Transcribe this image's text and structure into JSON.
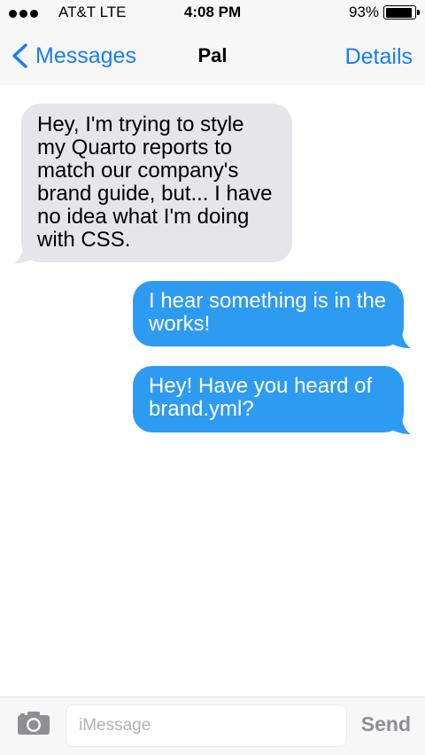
{
  "status_bar": {
    "carrier": "AT&T  LTE",
    "time": "4:08 PM",
    "battery": "93%",
    "battery_level": 0.93
  },
  "nav": {
    "back_label": "Messages",
    "title": "Pal",
    "details_label": "Details",
    "accent_color": "#1a7cf2"
  },
  "messages": [
    {
      "direction": "received",
      "text": "Hey, I'm trying to style\nmy Quarto reports to\nmatch our company's\nbrand guide, but... I have\nno idea what I'm doing\nwith CSS."
    },
    {
      "direction": "sent",
      "text": "I hear something is in the\nworks!"
    },
    {
      "direction": "sent",
      "text": "Hey! Have you heard of\nbrand.yml?"
    }
  ],
  "composer": {
    "camera_icon": "camera-icon",
    "placeholder": "iMessage",
    "value": "",
    "send_label": "Send"
  },
  "colors": {
    "sent_bubble": "#2e9bf3",
    "received_bubble": "#e5e5ea",
    "bar_background": "#f7f7f7"
  }
}
